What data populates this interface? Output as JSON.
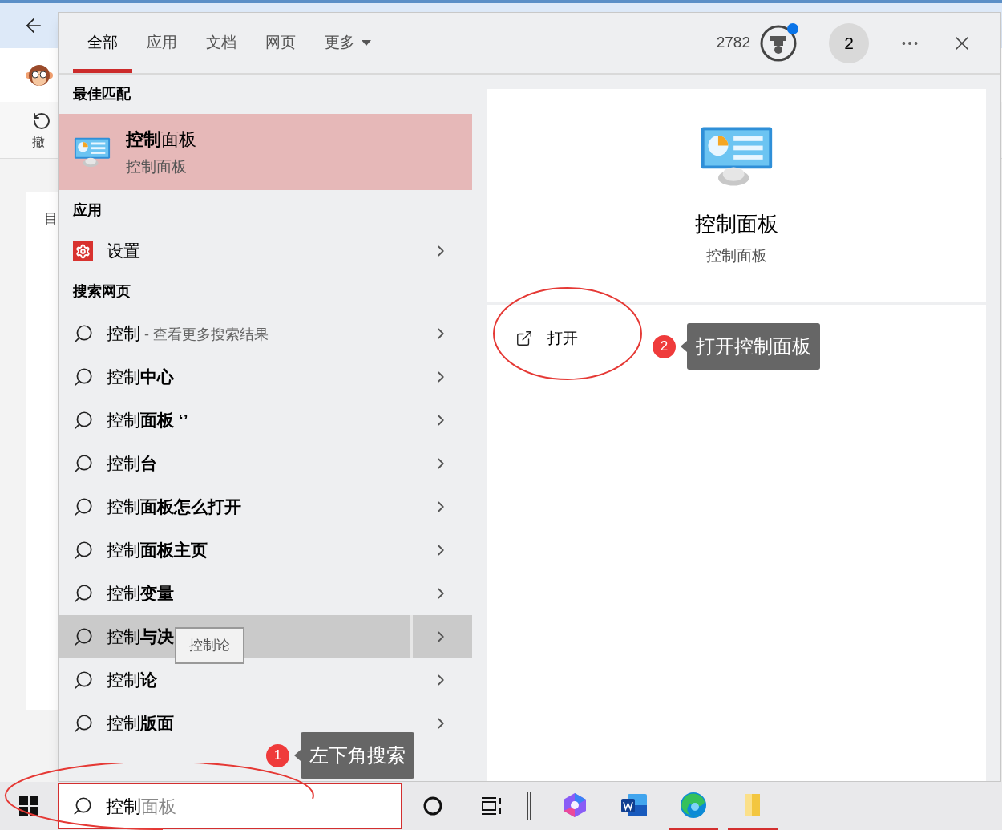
{
  "background_app": {
    "undo_label": "撤",
    "card_label": "目"
  },
  "tabs": [
    {
      "label": "全部",
      "selected": true,
      "kind": "plain"
    },
    {
      "label": "应用",
      "selected": false,
      "kind": "plain"
    },
    {
      "label": "文档",
      "selected": false,
      "kind": "plain"
    },
    {
      "label": "网页",
      "selected": false,
      "kind": "plain"
    },
    {
      "label": "更多",
      "selected": false,
      "kind": "dropdown"
    }
  ],
  "header": {
    "points": "2782",
    "account": "2"
  },
  "best_match": {
    "heading": "最佳匹配",
    "title": "**控制**面板",
    "subtitle": "控制面板"
  },
  "apps": {
    "heading": "应用",
    "items": [
      {
        "label": "设置"
      }
    ]
  },
  "web": {
    "heading": "搜索网页",
    "items": [
      {
        "text": "控制",
        "hint": "- 查看更多搜索结果",
        "hovered": false
      },
      {
        "text": "控制**中心**",
        "hovered": false
      },
      {
        "text": "控制**面板 ‘’**",
        "hovered": false
      },
      {
        "text": "控制**台**",
        "hovered": false
      },
      {
        "text": "控制**面板怎么打开**",
        "hovered": false
      },
      {
        "text": "控制**面板主页**",
        "hovered": false
      },
      {
        "text": "控制**变量**",
        "hovered": false
      },
      {
        "text": "控制**与决**",
        "hovered": true,
        "tooltip": "控制论"
      },
      {
        "text": "控制**论**",
        "hovered": false
      },
      {
        "text": "控制**版面**",
        "hovered": false
      }
    ]
  },
  "preview": {
    "title": "控制面板",
    "subtitle": "控制面板",
    "actions": [
      {
        "label": "打开"
      }
    ]
  },
  "taskbar": {
    "search": {
      "value": "控制",
      "suggestion": "面板"
    },
    "apps": [
      {
        "kind": "copilot",
        "running": false
      },
      {
        "kind": "word",
        "running": false
      },
      {
        "kind": "edge",
        "running": true
      },
      {
        "kind": "folder",
        "running": true
      }
    ]
  },
  "annotations": [
    {
      "number": "1",
      "text": "左下角搜索"
    },
    {
      "number": "2",
      "text": "打开控制面板"
    }
  ]
}
